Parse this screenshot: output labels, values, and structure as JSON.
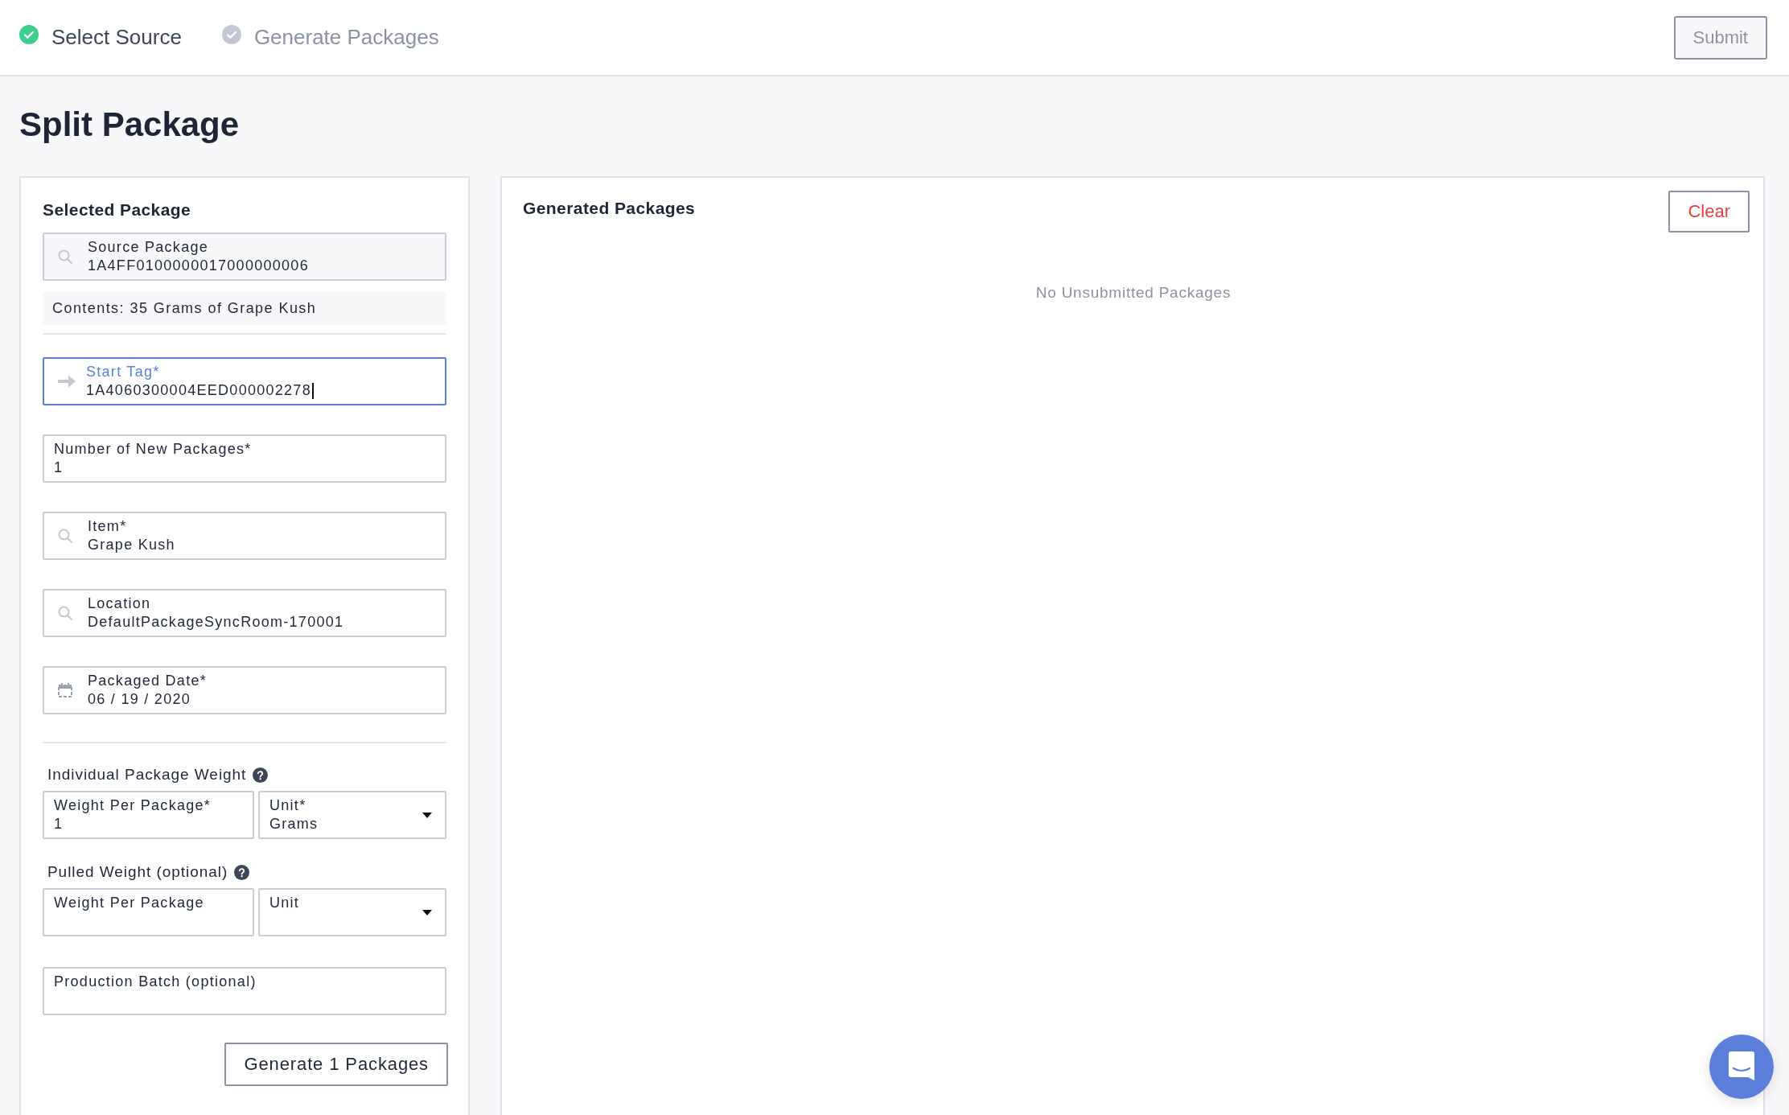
{
  "steps": [
    {
      "label": "Select Source",
      "completed": true
    },
    {
      "label": "Generate Packages",
      "completed": false
    }
  ],
  "submit_button": {
    "label": "Submit",
    "disabled": true
  },
  "page_title": "Split Package",
  "selected_panel": {
    "title": "Selected Package",
    "source_field": {
      "kind": "search",
      "label": "Source Package",
      "value": "1A4FF0100000017000000006"
    },
    "contents": "Contents: 35 Grams of Grape Kush",
    "fields": [
      {
        "kind": "tag",
        "label": "Start Tag*",
        "value": "1A4060300004EED000002278",
        "focused": true
      },
      {
        "kind": "number",
        "label": "Number of New Packages*",
        "value": "1",
        "focused": false
      },
      {
        "kind": "search",
        "label": "Item*",
        "value": "Grape Kush",
        "focused": false
      },
      {
        "kind": "search",
        "label": "Location",
        "value": "DefaultPackageSyncRoom-170001",
        "focused": false
      },
      {
        "kind": "date",
        "label": "Packaged Date*",
        "value": "06 / 19 / 2020",
        "focused": false
      }
    ],
    "weight_groups": [
      {
        "label": "Individual Package Weight",
        "fields": [
          {
            "kind": "input",
            "label": "Weight Per Package*",
            "value": "1"
          },
          {
            "kind": "select",
            "label": "Unit*",
            "value": "Grams"
          }
        ]
      },
      {
        "label": "Pulled Weight (optional)",
        "fields": [
          {
            "kind": "input",
            "label": "Weight Per Package"
          },
          {
            "kind": "select",
            "label": "Unit"
          }
        ]
      }
    ],
    "batch_field": {
      "label": "Production Batch (optional)"
    },
    "generate_button": "Generate 1 Packages"
  },
  "generated_panel": {
    "title": "Generated Packages",
    "clear_button": "Clear",
    "empty_message": "No Unsubmitted Packages"
  }
}
